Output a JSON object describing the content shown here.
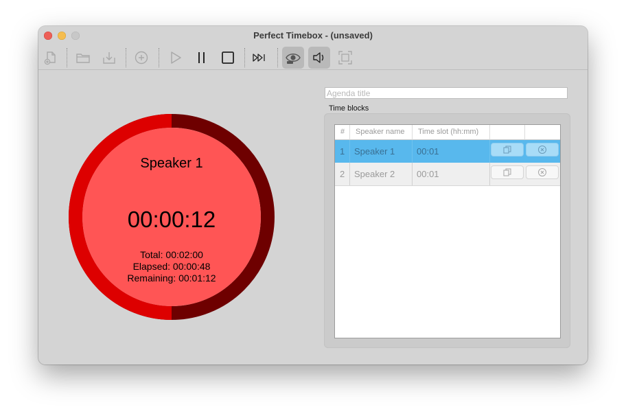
{
  "window": {
    "title": "Perfect Timebox -  (unsaved)"
  },
  "toolbar": {
    "items": [
      {
        "icon": "new-document-icon",
        "enabled": false
      },
      {
        "icon": "open-folder-icon",
        "enabled": false
      },
      {
        "icon": "save-download-icon",
        "enabled": false
      },
      {
        "icon": "add-circle-icon",
        "enabled": false
      },
      {
        "icon": "play-icon",
        "enabled": false
      },
      {
        "icon": "pause-icon",
        "enabled": true
      },
      {
        "icon": "stop-icon",
        "enabled": true
      },
      {
        "icon": "skip-forward-icon",
        "enabled": true
      },
      {
        "icon": "eye-view-icon",
        "enabled": true,
        "active": true
      },
      {
        "icon": "speaker-volume-icon",
        "enabled": true,
        "active": true
      },
      {
        "icon": "fullscreen-icon",
        "enabled": false
      }
    ]
  },
  "timer": {
    "speaker": "Speaker 1",
    "countdown": "00:00:12",
    "total": "Total: 00:02:00",
    "elapsed": "Elapsed: 00:00:48",
    "remaining": "Remaining: 00:01:12",
    "colors": {
      "face": "#ff5555",
      "ring_elapsed": "#6e0000",
      "ring_remaining": "#dd0000"
    }
  },
  "agenda": {
    "title_value": "",
    "title_placeholder": "Agenda title",
    "blocks_label": "Time blocks"
  },
  "table": {
    "columns": [
      "#",
      "Speaker name",
      "Time slot (hh:mm)",
      "",
      ""
    ],
    "rows": [
      {
        "index": "1",
        "speaker": "Speaker 1",
        "slot": "00:01",
        "selected": true
      },
      {
        "index": "2",
        "speaker": "Speaker 2",
        "slot": "00:01",
        "selected": false
      }
    ],
    "selection_color": "#58b8ed"
  }
}
